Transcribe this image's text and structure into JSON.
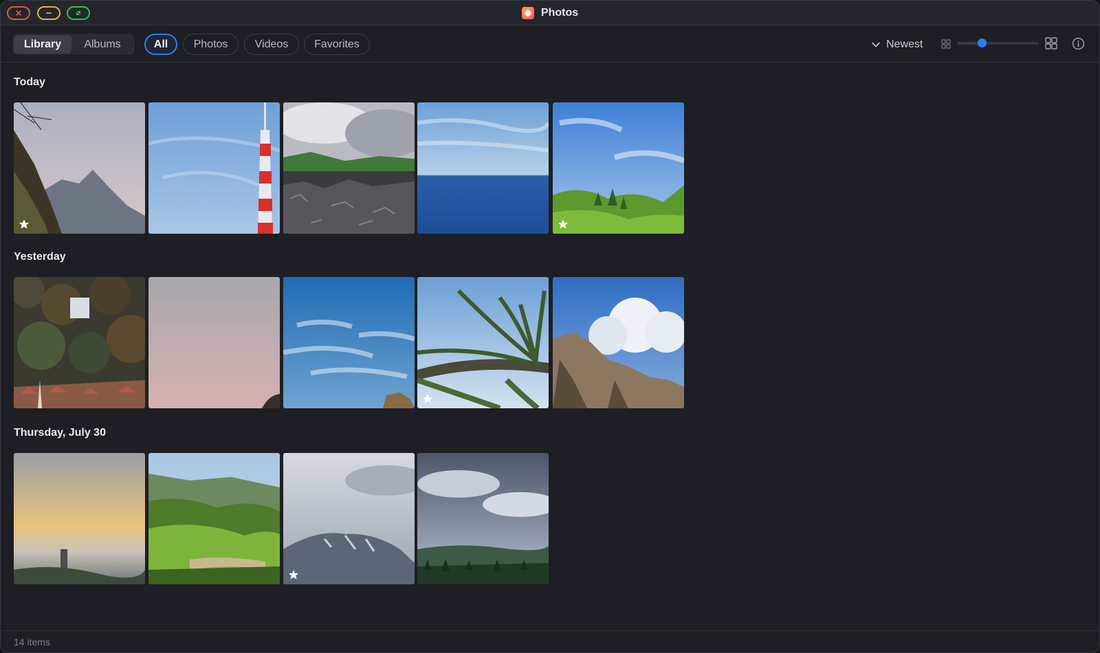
{
  "window": {
    "title": "Photos"
  },
  "toolbar": {
    "view_tabs": [
      {
        "label": "Library",
        "active": true
      },
      {
        "label": "Albums",
        "active": false
      }
    ],
    "filters": [
      {
        "label": "All",
        "active": true
      },
      {
        "label": "Photos",
        "active": false
      },
      {
        "label": "Videos",
        "active": false
      },
      {
        "label": "Favorites",
        "active": false
      }
    ],
    "sort_label": "Newest",
    "zoom_level": 0.3
  },
  "sections": [
    {
      "title": "Today",
      "photos": [
        {
          "scene": "mountain-cliff",
          "favorite": true
        },
        {
          "scene": "radio-tower",
          "favorite": false
        },
        {
          "scene": "lava-field",
          "favorite": false
        },
        {
          "scene": "ocean",
          "favorite": false
        },
        {
          "scene": "green-hills",
          "favorite": true
        }
      ]
    },
    {
      "title": "Yesterday",
      "photos": [
        {
          "scene": "forest-village",
          "favorite": false
        },
        {
          "scene": "pink-sky",
          "favorite": false
        },
        {
          "scene": "blue-sky",
          "favorite": false
        },
        {
          "scene": "palm-tree",
          "favorite": true
        },
        {
          "scene": "cliff-cloud",
          "favorite": false
        }
      ]
    },
    {
      "title": "Thursday, July 30",
      "photos": [
        {
          "scene": "sunset-haze",
          "favorite": false
        },
        {
          "scene": "green-valley",
          "favorite": false
        },
        {
          "scene": "snowy-peak",
          "favorite": true
        },
        {
          "scene": "cloudy-forest",
          "favorite": false
        }
      ]
    }
  ],
  "status": {
    "count_label": "14 items"
  },
  "colors": {
    "accent": "#2f7bf0",
    "background": "#1e1f24"
  }
}
